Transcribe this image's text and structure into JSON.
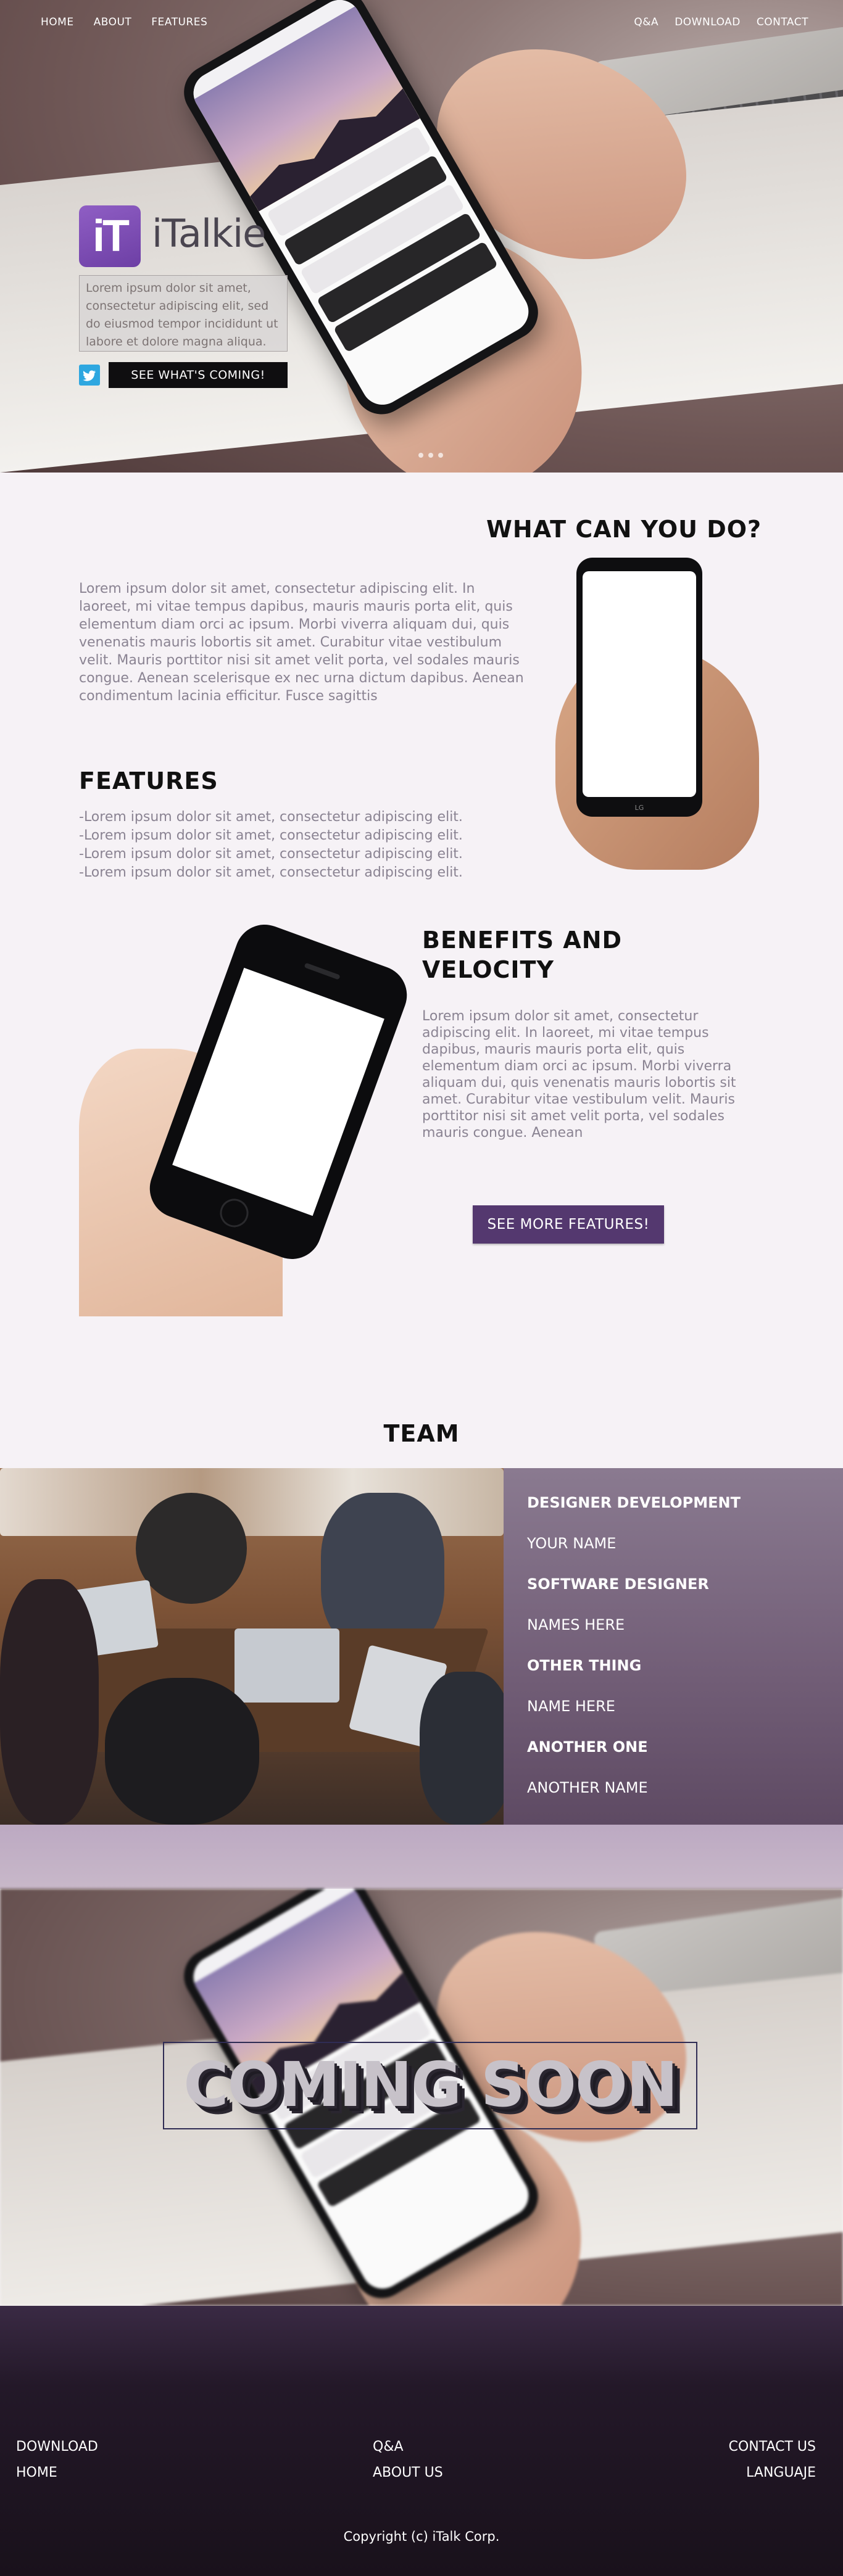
{
  "nav": {
    "left": [
      "HOME",
      "ABOUT",
      "FEATURES"
    ],
    "right": [
      "Q&A",
      "DOWNLOAD",
      "CONTACT"
    ]
  },
  "hero": {
    "logo_mark": "iT",
    "logo_name": "iTalkie",
    "blurb": "Lorem ipsum dolor sit amet, consectetur adipiscing elit, sed do eiusmod tempor incididunt ut labore et dolore magna aliqua.",
    "cta": "SEE WHAT'S COMING!",
    "slide_count": 3
  },
  "what": {
    "title": "WHAT CAN YOU DO?",
    "body": "Lorem ipsum dolor sit amet, consectetur adipiscing elit. In laoreet, mi vitae tempus dapibus, mauris mauris porta elit, quis elementum diam orci ac ipsum. Morbi viverra aliquam dui, quis venenatis mauris lobortis sit amet. Curabitur vitae vestibulum velit. Mauris porttitor nisi sit amet velit porta, vel sodales mauris congue. Aenean scelerisque ex nec urna dictum dapibus. Aenean condimentum lacinia efficitur. Fusce sagittis",
    "phone_brand": "LG"
  },
  "features": {
    "title": "FEATURES",
    "items": [
      "-Lorem ipsum dolor sit amet, consectetur adipiscing elit.",
      "-Lorem ipsum dolor sit amet, consectetur adipiscing elit.",
      "-Lorem ipsum dolor sit amet, consectetur adipiscing elit.",
      "-Lorem ipsum dolor sit amet, consectetur adipiscing elit."
    ]
  },
  "benefits": {
    "title_line1": "BENEFITS AND",
    "title_line2": "VELOCITY",
    "body": "Lorem ipsum dolor sit amet, consectetur adipiscing elit. In laoreet, mi vitae tempus dapibus, mauris mauris porta elit, quis elementum diam orci ac ipsum. Morbi viverra aliquam dui, quis venenatis mauris lobortis sit amet. Curabitur vitae vestibulum velit. Mauris porttitor nisi sit amet velit porta, vel sodales mauris congue. Aenean",
    "button": "SEE MORE FEATURES!"
  },
  "team": {
    "title": "TEAM",
    "members": [
      {
        "role": "DESIGNER DEVELOPMENT",
        "name": "YOUR NAME"
      },
      {
        "role": "SOFTWARE DESIGNER",
        "name": "NAMES HERE"
      },
      {
        "role": "OTHER THING",
        "name": "NAME HERE"
      },
      {
        "role": "ANOTHER ONE",
        "name": "ANOTHER NAME"
      }
    ]
  },
  "coming_soon": {
    "text": "COMING SOON"
  },
  "footer": {
    "col1": [
      "DOWNLOAD",
      "HOME"
    ],
    "col2": [
      "Q&A",
      "ABOUT US"
    ],
    "col3": [
      "CONTACT US",
      "LANGUAJE"
    ],
    "copyright": "Copyright (c) iTalk Corp."
  },
  "colors": {
    "accent": "#54386f",
    "logo": "#7c4db5",
    "team_panel": "#735f78",
    "footer": "#19111b",
    "twitter": "#2ea7e0"
  },
  "icons": [
    "twitter-icon"
  ]
}
